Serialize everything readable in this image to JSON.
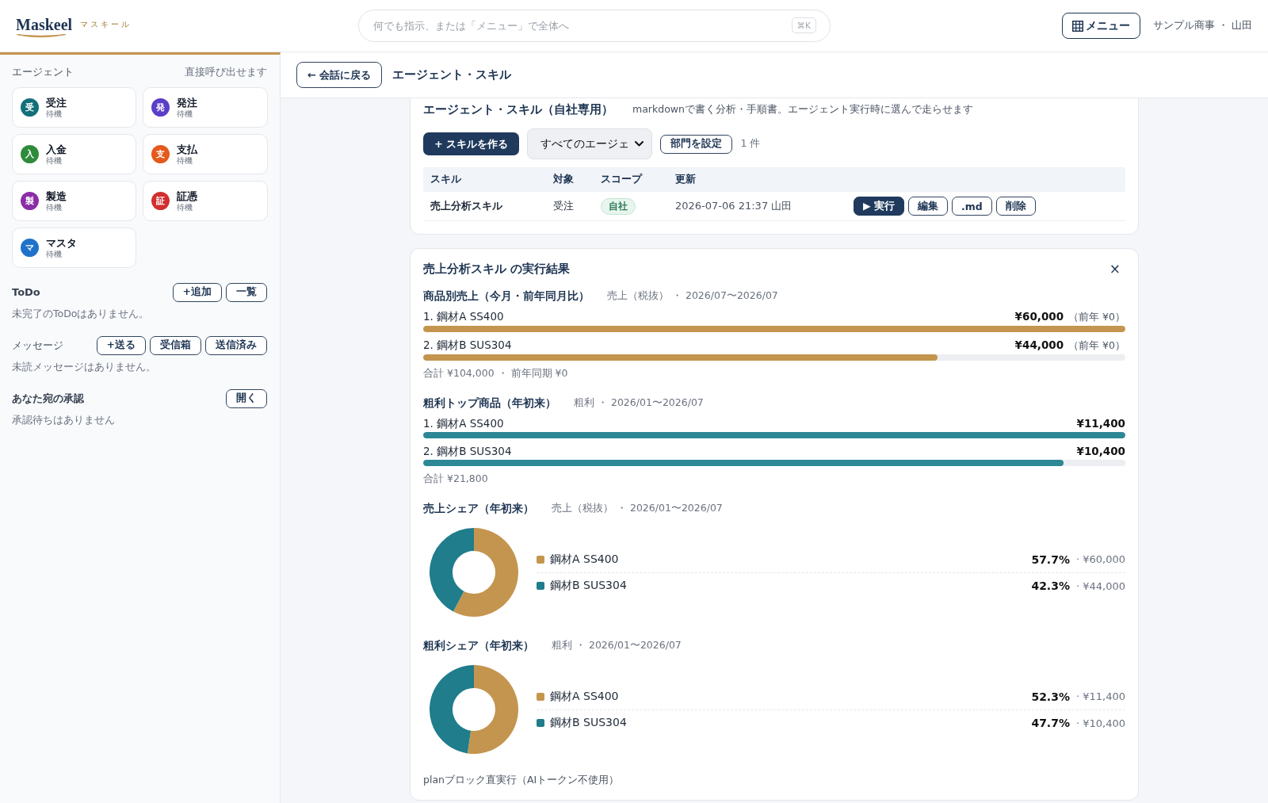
{
  "header": {
    "logo": {
      "wordmark": "Maskeel",
      "kana": "マスキール"
    },
    "search": {
      "placeholder": "何でも指示、または「メニュー」で全体へ",
      "shortcut": "⌘K"
    },
    "menu_button": "メニュー",
    "account": "サンプル商事 ・ 山田"
  },
  "sidebar": {
    "agents": {
      "title": "エージェント",
      "hint": "直接呼び出せます",
      "items": [
        {
          "initial": "受",
          "name": "受注",
          "status": "待機",
          "color": "#13707a"
        },
        {
          "initial": "発",
          "name": "発注",
          "status": "待機",
          "color": "#5a3ec8"
        },
        {
          "initial": "入",
          "name": "入金",
          "status": "待機",
          "color": "#2e8b3c"
        },
        {
          "initial": "支",
          "name": "支払",
          "status": "待機",
          "color": "#e4591c"
        },
        {
          "initial": "製",
          "name": "製造",
          "status": "待機",
          "color": "#8a2ea6"
        },
        {
          "initial": "証",
          "name": "証憑",
          "status": "待機",
          "color": "#d12f2f"
        },
        {
          "initial": "マ",
          "name": "マスタ",
          "status": "待機",
          "color": "#1f72c9"
        }
      ]
    },
    "sections": [
      {
        "title": "ToDo",
        "bold": true,
        "buttons": [
          "+追加",
          "一覧"
        ],
        "empty": "未完了のToDoはありません。"
      },
      {
        "title": "メッセージ",
        "bold": false,
        "buttons": [
          "+送る",
          "受信箱",
          "送信済み"
        ],
        "empty": "未読メッセージはありません。"
      },
      {
        "title": "あなた宛の承認",
        "bold": true,
        "buttons": [
          "開く"
        ],
        "empty": "承認待ちはありません"
      }
    ]
  },
  "page_bar": {
    "back_button": "← 会話に戻る",
    "title": "エージェント・スキル"
  },
  "skills_card": {
    "title": "エージェント・スキル（自社専用）",
    "description": "markdownで書く分析・手順書。エージェント実行時に選んで走らせます",
    "create_button": "+ スキルを作る",
    "agent_filter": {
      "value": "すべてのエージェ"
    },
    "department_button": "部門を設定",
    "count": "1 件",
    "table": {
      "columns": [
        "スキル",
        "対象",
        "スコープ",
        "更新"
      ],
      "rows": [
        {
          "skill": "売上分析スキル",
          "target": "受注",
          "scope": "自社",
          "updated": "2026-07-06 21:37 山田",
          "actions": [
            {
              "label": "▶ 実行",
              "kind": "primary"
            },
            {
              "label": "編集",
              "kind": "outline"
            },
            {
              "label": ".md",
              "kind": "outline"
            },
            {
              "label": "削除",
              "kind": "outline"
            }
          ]
        }
      ]
    }
  },
  "result": {
    "title": "売上分析スキル の実行結果",
    "close": "×",
    "blocks": [
      {
        "kind": "bars",
        "title": "商品別売上（今月・前年同月比）",
        "meta": "売上（税抜） ・ 2026/07〜2026/07",
        "color": "#c4954f",
        "items": [
          {
            "label": "1. 鋼材A SS400",
            "value": "¥60,000",
            "prior": "（前年 ¥0）",
            "level": 1
          },
          {
            "label": "2. 鋼材B SUS304",
            "value": "¥44,000",
            "prior": "（前年 ¥0）",
            "level": 0.733
          }
        ],
        "total": "合計 ¥104,000 ・ 前年同期 ¥0"
      },
      {
        "kind": "bars",
        "title": "粗利トップ商品（年初来）",
        "meta": "粗利 ・ 2026/01〜2026/07",
        "color": "#2d8795",
        "items": [
          {
            "label": "1. 鋼材A SS400",
            "value": "¥11,400",
            "level": 1
          },
          {
            "label": "2. 鋼材B SUS304",
            "value": "¥10,400",
            "level": 0.912
          }
        ],
        "total": "合計 ¥21,800"
      },
      {
        "kind": "donut",
        "title": "売上シェア（年初来）",
        "meta": "売上（税抜） ・ 2026/01〜2026/07",
        "chart_data": {
          "type": "donut",
          "categories": [
            "鋼材A SS400",
            "鋼材B SUS304"
          ],
          "values": [
            57.7,
            42.3
          ]
        },
        "legend": [
          {
            "color": "#c4954f",
            "percent": "57.7%",
            "amount": "· ¥60,000"
          },
          {
            "color": "#1f7d8c",
            "percent": "42.3%",
            "amount": "· ¥44,000"
          }
        ]
      },
      {
        "kind": "donut",
        "title": "粗利シェア（年初来）",
        "meta": "粗利 ・ 2026/01〜2026/07",
        "chart_data": {
          "type": "donut",
          "categories": [
            "鋼材A SS400",
            "鋼材B SUS304"
          ],
          "values": [
            52.3,
            47.7
          ]
        },
        "legend": [
          {
            "color": "#c4954f",
            "percent": "52.3%",
            "amount": "· ¥11,400"
          },
          {
            "color": "#1f7d8c",
            "percent": "47.7%",
            "amount": "· ¥10,400"
          }
        ]
      }
    ],
    "footnote": "planブロック直実行（AIトークン不使用）"
  }
}
